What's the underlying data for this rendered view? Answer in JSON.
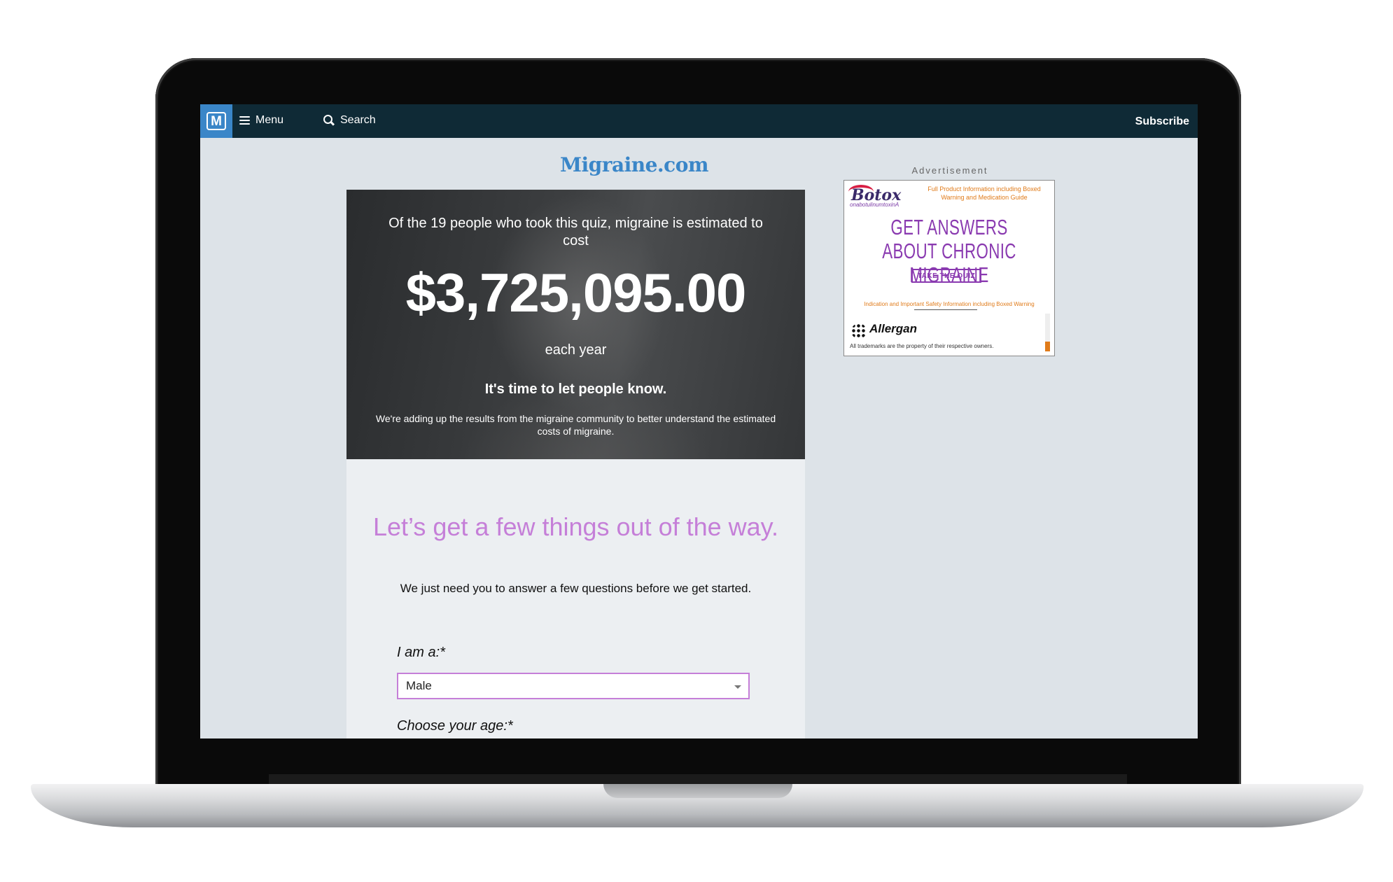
{
  "nav": {
    "logo_letter": "M",
    "menu_label": "Menu",
    "search_label": "Search",
    "subscribe_label": "Subscribe"
  },
  "site": {
    "title": "Migraine.com"
  },
  "hero": {
    "intro": "Of the 19 people who took this quiz, migraine is estimated to cost",
    "amount": "$3,725,095.00",
    "period": "each year",
    "cta": "It's time to let people know.",
    "description": "We're adding up the results from the migraine community to better understand the estimated costs of migraine."
  },
  "form": {
    "heading": "Let’s get a few things out of the way.",
    "subheading": "We just need you to answer a few questions before we get started.",
    "gender_label": "I am a:*",
    "gender_value": "Male",
    "age_label": "Choose your age:*"
  },
  "ad": {
    "label": "Advertisement",
    "brand": "Botox",
    "generic": "onabotulinumtoxinA",
    "links": "Full Product Information including Boxed Warning and Medication Guide",
    "headline": "GET ANSWERS ABOUT CHRONIC MIGRAINE",
    "button": "TAKE THE QUIZ",
    "safety": "Indication and Important Safety Information including Boxed Warning",
    "maker": "Allergan",
    "legal": "All trademarks are the property of their respective owners.",
    "accent_color": "#8a3ab0",
    "link_color": "#e07b1a"
  },
  "colors": {
    "nav_bg": "#0f2a36",
    "logo_bg": "#3a86c8",
    "heading_purple": "#c57fd8",
    "page_bg": "#dde3e8"
  }
}
